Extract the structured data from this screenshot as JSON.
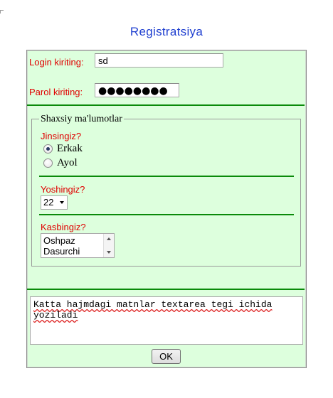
{
  "page": {
    "title": "Registratsiya"
  },
  "login": {
    "label": "Login kiriting:",
    "value": "sd"
  },
  "password": {
    "label": "Parol kiriting:",
    "value": "●●●●●●●●"
  },
  "personal": {
    "legend": "Shaxsiy ma'lumotlar",
    "gender": {
      "label": "Jinsingiz?",
      "options": [
        {
          "label": "Erkak",
          "checked": true
        },
        {
          "label": "Ayol",
          "checked": false
        }
      ]
    },
    "age": {
      "label": "Yoshingiz?",
      "selected": "22"
    },
    "profession": {
      "label": "Kasbingiz?",
      "options": [
        "Oshpaz",
        "Dasurchi"
      ]
    }
  },
  "textarea": {
    "value": "Katta hajmdagi matnlar textarea tegi ichida yoziladi"
  },
  "submit": {
    "label": "OK"
  },
  "colors": {
    "title": "#1f3fd0",
    "label": "#e00000",
    "form_bg": "#ddffdd",
    "divider": "#0a8a0a"
  }
}
